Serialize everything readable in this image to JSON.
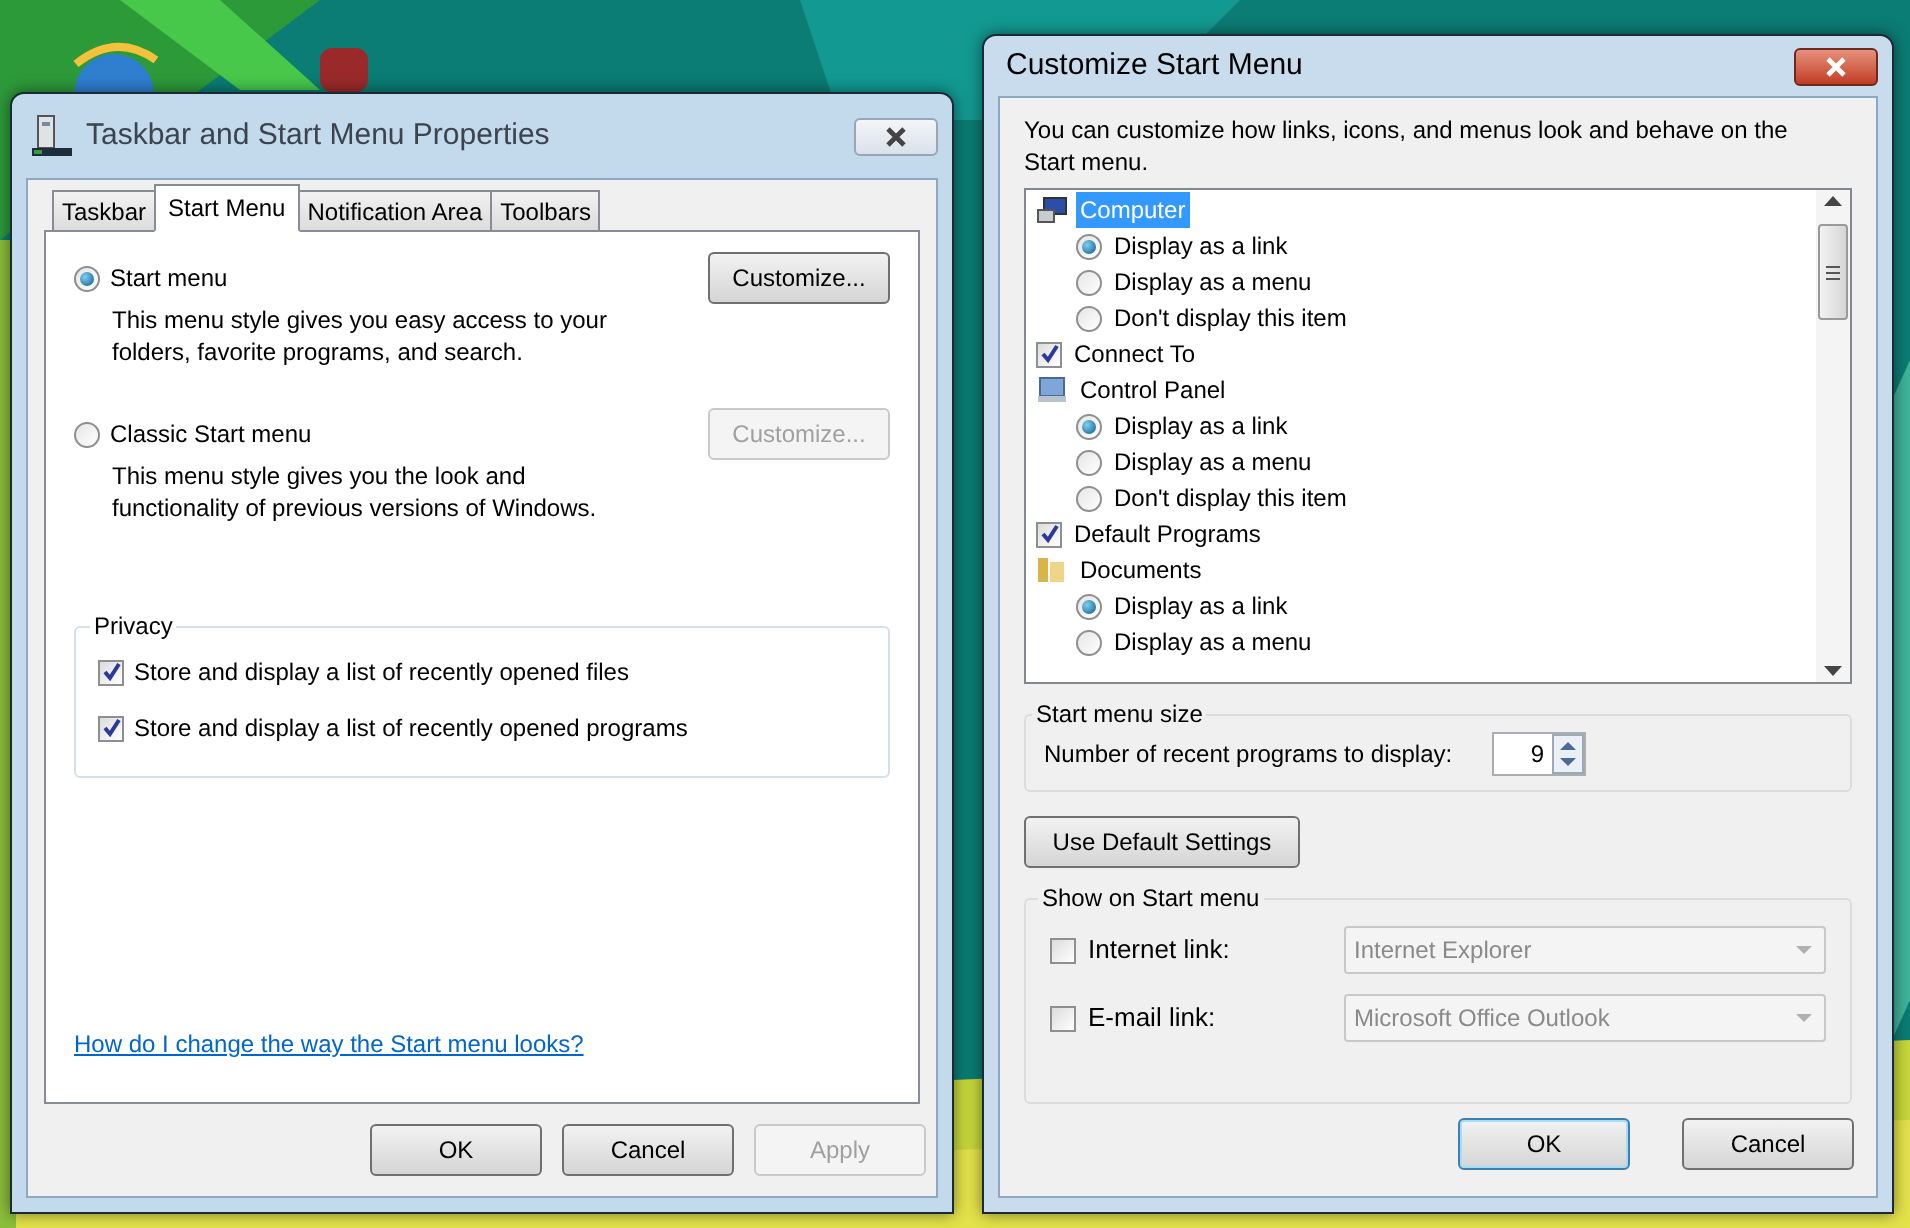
{
  "properties_window": {
    "title": "Taskbar and Start Menu Properties",
    "tabs": [
      {
        "label": "Taskbar",
        "selected": false
      },
      {
        "label": "Start Menu",
        "selected": true
      },
      {
        "label": "Notification Area",
        "selected": false
      },
      {
        "label": "Toolbars",
        "selected": false
      }
    ],
    "options": [
      {
        "label": "Start menu",
        "description": "This menu style gives you easy access to your folders, favorite programs, and search.",
        "selected": true,
        "button": {
          "label": "Customize...",
          "disabled": false
        }
      },
      {
        "label": "Classic Start menu",
        "description": "This menu style gives you the look and functionality of previous versions of Windows.",
        "selected": false,
        "button": {
          "label": "Customize...",
          "disabled": true
        }
      }
    ],
    "privacy": {
      "title": "Privacy",
      "items": [
        {
          "label": "Store and display a list of recently opened files",
          "checked": true
        },
        {
          "label": "Store and display a list of recently opened programs",
          "checked": true
        }
      ]
    },
    "help_link": "How do I change the way the Start menu looks?",
    "buttons": [
      {
        "label": "OK",
        "disabled": false
      },
      {
        "label": "Cancel",
        "disabled": false
      },
      {
        "label": "Apply",
        "disabled": true
      }
    ]
  },
  "customize_window": {
    "title": "Customize Start Menu",
    "description": "You can customize how links, icons, and menus look and behave on the Start menu.",
    "tree": [
      {
        "kind": "group",
        "label": "Computer",
        "selected": true,
        "children": [
          {
            "label": "Display as a link",
            "selected": true
          },
          {
            "label": "Display as a menu",
            "selected": false
          },
          {
            "label": "Don't display this item",
            "selected": false
          }
        ]
      },
      {
        "kind": "checkbox",
        "label": "Connect To",
        "checked": true
      },
      {
        "kind": "group",
        "label": "Control Panel",
        "selected": false,
        "children": [
          {
            "label": "Display as a link",
            "selected": true
          },
          {
            "label": "Display as a menu",
            "selected": false
          },
          {
            "label": "Don't display this item",
            "selected": false
          }
        ]
      },
      {
        "kind": "checkbox",
        "label": "Default Programs",
        "checked": true
      },
      {
        "kind": "group",
        "label": "Documents",
        "selected": false,
        "children": [
          {
            "label": "Display as a link",
            "selected": true
          },
          {
            "label": "Display as a menu",
            "selected": false
          }
        ]
      }
    ],
    "size_group": {
      "title": "Start menu size",
      "label": "Number of recent programs to display:",
      "value": "9"
    },
    "default_button": "Use Default Settings",
    "show_group": {
      "title": "Show on Start menu",
      "items": [
        {
          "label": "Internet link:",
          "checked": false,
          "value": "Internet Explorer",
          "disabled": true
        },
        {
          "label": "E-mail link:",
          "checked": false,
          "value": "Microsoft Office Outlook",
          "disabled": true
        }
      ]
    },
    "buttons": [
      {
        "label": "OK",
        "default": true
      },
      {
        "label": "Cancel",
        "default": false
      }
    ]
  }
}
